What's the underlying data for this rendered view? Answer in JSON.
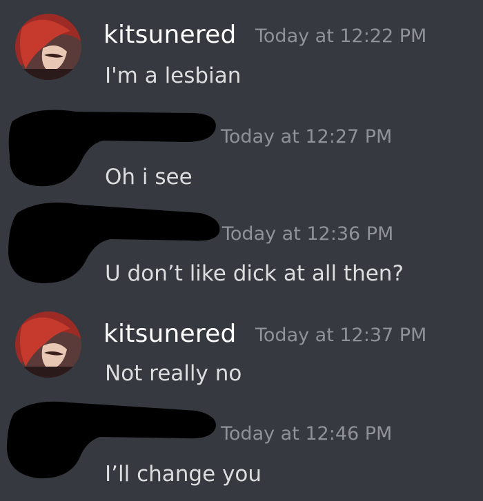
{
  "messages": [
    {
      "author": "kitsunered",
      "timestamp": "Today at 12:22 PM",
      "content": "I'm a lesbian",
      "avatar": "anime-avatar-icon"
    },
    {
      "author": "",
      "timestamp": "Today at 12:27 PM",
      "content": "Oh i see",
      "avatar": "redacted"
    },
    {
      "author": "",
      "timestamp": "Today at 12:36 PM",
      "content": "U don’t like dick at all then?",
      "avatar": "redacted"
    },
    {
      "author": "kitsunered",
      "timestamp": "Today at 12:37 PM",
      "content": "Not really no",
      "avatar": "anime-avatar-icon"
    },
    {
      "author": "",
      "timestamp": "Today at 12:46 PM",
      "content": "I’ll change you",
      "avatar": "redacted"
    }
  ],
  "colors": {
    "background": "#36393f",
    "username": "#ffffff",
    "timestamp": "#8f9297",
    "message_text": "#dcddde",
    "redaction": "#000000"
  }
}
